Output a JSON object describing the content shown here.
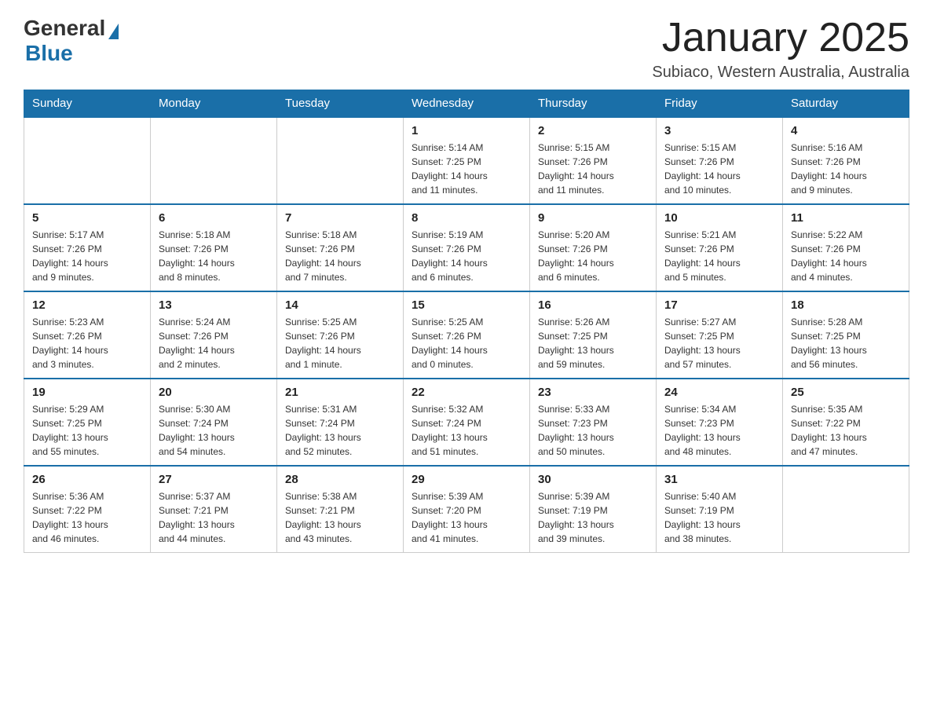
{
  "header": {
    "logo_general": "General",
    "logo_blue": "Blue",
    "month_title": "January 2025",
    "location": "Subiaco, Western Australia, Australia"
  },
  "days_of_week": [
    "Sunday",
    "Monday",
    "Tuesday",
    "Wednesday",
    "Thursday",
    "Friday",
    "Saturday"
  ],
  "weeks": [
    [
      {
        "day": "",
        "info": ""
      },
      {
        "day": "",
        "info": ""
      },
      {
        "day": "",
        "info": ""
      },
      {
        "day": "1",
        "info": "Sunrise: 5:14 AM\nSunset: 7:25 PM\nDaylight: 14 hours\nand 11 minutes."
      },
      {
        "day": "2",
        "info": "Sunrise: 5:15 AM\nSunset: 7:26 PM\nDaylight: 14 hours\nand 11 minutes."
      },
      {
        "day": "3",
        "info": "Sunrise: 5:15 AM\nSunset: 7:26 PM\nDaylight: 14 hours\nand 10 minutes."
      },
      {
        "day": "4",
        "info": "Sunrise: 5:16 AM\nSunset: 7:26 PM\nDaylight: 14 hours\nand 9 minutes."
      }
    ],
    [
      {
        "day": "5",
        "info": "Sunrise: 5:17 AM\nSunset: 7:26 PM\nDaylight: 14 hours\nand 9 minutes."
      },
      {
        "day": "6",
        "info": "Sunrise: 5:18 AM\nSunset: 7:26 PM\nDaylight: 14 hours\nand 8 minutes."
      },
      {
        "day": "7",
        "info": "Sunrise: 5:18 AM\nSunset: 7:26 PM\nDaylight: 14 hours\nand 7 minutes."
      },
      {
        "day": "8",
        "info": "Sunrise: 5:19 AM\nSunset: 7:26 PM\nDaylight: 14 hours\nand 6 minutes."
      },
      {
        "day": "9",
        "info": "Sunrise: 5:20 AM\nSunset: 7:26 PM\nDaylight: 14 hours\nand 6 minutes."
      },
      {
        "day": "10",
        "info": "Sunrise: 5:21 AM\nSunset: 7:26 PM\nDaylight: 14 hours\nand 5 minutes."
      },
      {
        "day": "11",
        "info": "Sunrise: 5:22 AM\nSunset: 7:26 PM\nDaylight: 14 hours\nand 4 minutes."
      }
    ],
    [
      {
        "day": "12",
        "info": "Sunrise: 5:23 AM\nSunset: 7:26 PM\nDaylight: 14 hours\nand 3 minutes."
      },
      {
        "day": "13",
        "info": "Sunrise: 5:24 AM\nSunset: 7:26 PM\nDaylight: 14 hours\nand 2 minutes."
      },
      {
        "day": "14",
        "info": "Sunrise: 5:25 AM\nSunset: 7:26 PM\nDaylight: 14 hours\nand 1 minute."
      },
      {
        "day": "15",
        "info": "Sunrise: 5:25 AM\nSunset: 7:26 PM\nDaylight: 14 hours\nand 0 minutes."
      },
      {
        "day": "16",
        "info": "Sunrise: 5:26 AM\nSunset: 7:25 PM\nDaylight: 13 hours\nand 59 minutes."
      },
      {
        "day": "17",
        "info": "Sunrise: 5:27 AM\nSunset: 7:25 PM\nDaylight: 13 hours\nand 57 minutes."
      },
      {
        "day": "18",
        "info": "Sunrise: 5:28 AM\nSunset: 7:25 PM\nDaylight: 13 hours\nand 56 minutes."
      }
    ],
    [
      {
        "day": "19",
        "info": "Sunrise: 5:29 AM\nSunset: 7:25 PM\nDaylight: 13 hours\nand 55 minutes."
      },
      {
        "day": "20",
        "info": "Sunrise: 5:30 AM\nSunset: 7:24 PM\nDaylight: 13 hours\nand 54 minutes."
      },
      {
        "day": "21",
        "info": "Sunrise: 5:31 AM\nSunset: 7:24 PM\nDaylight: 13 hours\nand 52 minutes."
      },
      {
        "day": "22",
        "info": "Sunrise: 5:32 AM\nSunset: 7:24 PM\nDaylight: 13 hours\nand 51 minutes."
      },
      {
        "day": "23",
        "info": "Sunrise: 5:33 AM\nSunset: 7:23 PM\nDaylight: 13 hours\nand 50 minutes."
      },
      {
        "day": "24",
        "info": "Sunrise: 5:34 AM\nSunset: 7:23 PM\nDaylight: 13 hours\nand 48 minutes."
      },
      {
        "day": "25",
        "info": "Sunrise: 5:35 AM\nSunset: 7:22 PM\nDaylight: 13 hours\nand 47 minutes."
      }
    ],
    [
      {
        "day": "26",
        "info": "Sunrise: 5:36 AM\nSunset: 7:22 PM\nDaylight: 13 hours\nand 46 minutes."
      },
      {
        "day": "27",
        "info": "Sunrise: 5:37 AM\nSunset: 7:21 PM\nDaylight: 13 hours\nand 44 minutes."
      },
      {
        "day": "28",
        "info": "Sunrise: 5:38 AM\nSunset: 7:21 PM\nDaylight: 13 hours\nand 43 minutes."
      },
      {
        "day": "29",
        "info": "Sunrise: 5:39 AM\nSunset: 7:20 PM\nDaylight: 13 hours\nand 41 minutes."
      },
      {
        "day": "30",
        "info": "Sunrise: 5:39 AM\nSunset: 7:19 PM\nDaylight: 13 hours\nand 39 minutes."
      },
      {
        "day": "31",
        "info": "Sunrise: 5:40 AM\nSunset: 7:19 PM\nDaylight: 13 hours\nand 38 minutes."
      },
      {
        "day": "",
        "info": ""
      }
    ]
  ]
}
